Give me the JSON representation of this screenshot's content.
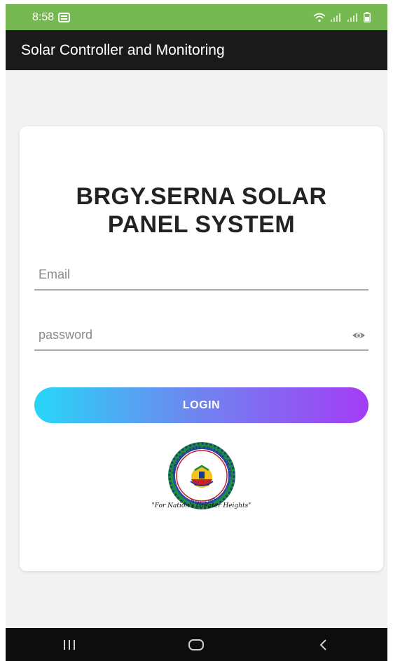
{
  "status_bar": {
    "time": "8:58",
    "notification_icon": "message-icon",
    "right_icons": [
      "wifi-icon",
      "signal-icon",
      "signal-icon",
      "battery-icon"
    ]
  },
  "app_bar": {
    "title": "Solar Controller and Monitoring"
  },
  "login": {
    "title_line1": "BRGY.SERNA SOLAR",
    "title_line2": "PANEL SYSTEM",
    "email_placeholder": "Email",
    "password_placeholder": "password",
    "password_toggle_icon": "eye-icon",
    "login_label": "LOGIN",
    "login_gradient": [
      "#28d6f8",
      "#a43cf5"
    ],
    "logo": {
      "ring_text": "SURIGAO STATE COLLEGE OF TECHNOLOGY",
      "bottom_text": "SURIGAO CITY",
      "tagline": "\"For Nation's Greater Heights\""
    }
  },
  "nav_bar": {
    "buttons": [
      "recents-icon",
      "home-icon",
      "back-icon"
    ]
  },
  "colors": {
    "status_bar": "#76b852",
    "app_bar": "#1a1a1a",
    "background": "#f2f2f2",
    "card": "#ffffff"
  }
}
